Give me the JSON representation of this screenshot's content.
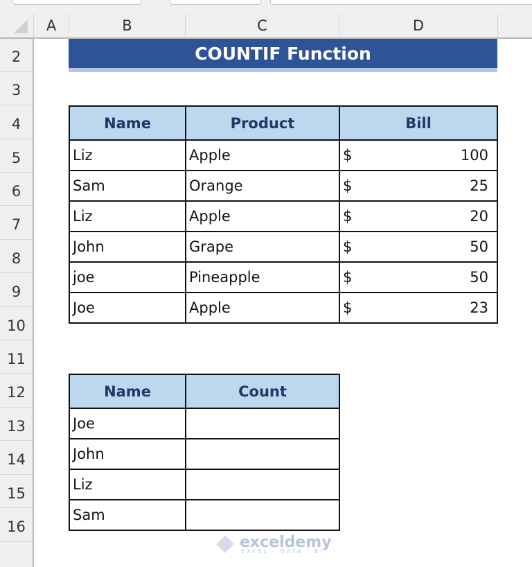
{
  "columns": [
    "A",
    "B",
    "C",
    "D"
  ],
  "rows": [
    "2",
    "3",
    "4",
    "5",
    "6",
    "7",
    "8",
    "9",
    "10",
    "11",
    "12",
    "13",
    "14",
    "15",
    "16"
  ],
  "title": "COUNTIF Function",
  "main_table": {
    "headers": [
      "Name",
      "Product",
      "Bill"
    ],
    "rows": [
      {
        "name": "Liz",
        "product": "Apple",
        "currency": "$",
        "bill": "100"
      },
      {
        "name": "Sam",
        "product": "Orange",
        "currency": "$",
        "bill": "25"
      },
      {
        "name": "Liz",
        "product": "Apple",
        "currency": "$",
        "bill": "20"
      },
      {
        "name": "John",
        "product": "Grape",
        "currency": "$",
        "bill": "50"
      },
      {
        "name": "joe",
        "product": "Pineapple",
        "currency": "$",
        "bill": "50"
      },
      {
        "name": "Joe",
        "product": "Apple",
        "currency": "$",
        "bill": "23"
      }
    ]
  },
  "count_table": {
    "headers": [
      "Name",
      "Count"
    ],
    "rows": [
      {
        "name": "Joe",
        "count": ""
      },
      {
        "name": "John",
        "count": ""
      },
      {
        "name": "Liz",
        "count": ""
      },
      {
        "name": "Sam",
        "count": ""
      }
    ]
  },
  "watermark": {
    "brand": "exceldemy",
    "tagline": "EXCEL · DATA · BI"
  },
  "colors": {
    "title_bg": "#2f5496",
    "header_bg": "#bdd7ee",
    "header_text": "#1f3864"
  }
}
